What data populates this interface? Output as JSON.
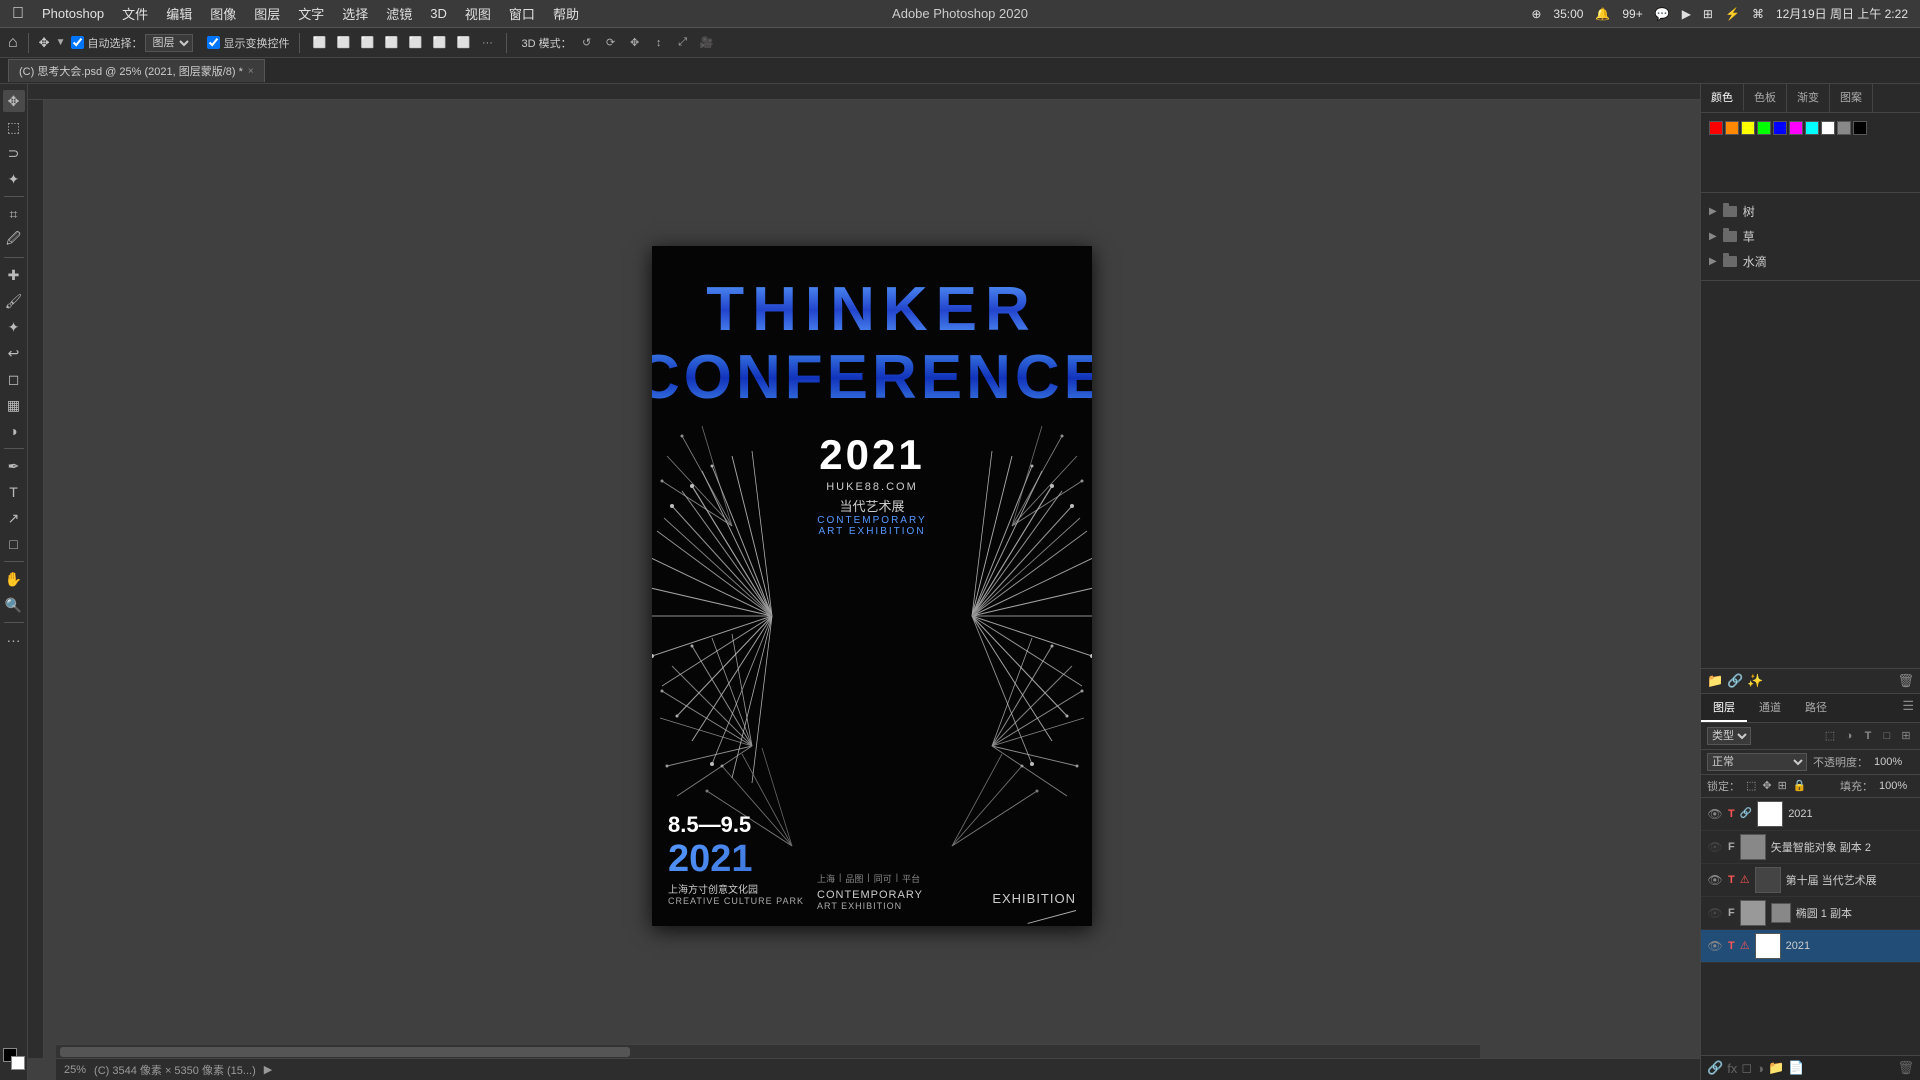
{
  "macos": {
    "apple": "&#63743;",
    "app_name": "Photoshop",
    "menus": [
      "文件",
      "编辑",
      "图像",
      "图层",
      "文字",
      "选择",
      "滤镜",
      "3D",
      "视图",
      "窗口",
      "帮助"
    ],
    "window_title": "Adobe Photoshop 2020",
    "right_icons": "35:00  99+  12月19日 周日 上午 2:22",
    "timer": "35:00",
    "notifications": "99+",
    "datetime": "12月19日 周日 上午 2:22"
  },
  "toolbar": {
    "auto_select_label": "自动选择：",
    "layer_option": "图层",
    "transform_label": "显示变换控件",
    "mode_label": "3D 模式："
  },
  "tab": {
    "title": "(C) 思考大会.psd @ 25% (2021, 图层蒙版/8) *",
    "close": "×"
  },
  "canvas": {
    "zoom": "25%",
    "info": "(C) 3544 像素 × 5350 像素 (15...)"
  },
  "poster": {
    "title_line1": "THINKER",
    "title_line2": "CONFERENCE",
    "year": "2021",
    "url": "HUKE88.COM",
    "chinese_subtitle": "当代艺术展",
    "subtitle_blue": "CONTEMPORARY",
    "subtitle_blue2": "ART EXHIBITION",
    "date": "8.5—9.5",
    "year_bottom": "2021",
    "park_chinese": "上海方寸创意文化园",
    "park_en": "CREATIVE CULTURE PARK",
    "contemp": "CONTEMPORARY",
    "art_exh": "ART EXHIBITION",
    "exhibition": "EXHIBITION"
  },
  "right_panel": {
    "top_tabs": [
      "颜色",
      "色板",
      "渐变",
      "图案"
    ],
    "layer_groups": [
      {
        "name": "树",
        "has_arrow": true
      },
      {
        "name": "草",
        "has_arrow": true
      },
      {
        "name": "水滴",
        "has_arrow": true
      }
    ]
  },
  "layers_panel": {
    "tabs": [
      "图层",
      "通道",
      "路径"
    ],
    "blend_mode": "正常",
    "opacity_label": "不透明度：",
    "opacity_val": "100%",
    "lock_label": "锁定：",
    "fill_label": "填充：",
    "fill_val": "100%",
    "search_placeholder": "类型",
    "layers": [
      {
        "name": "2021",
        "type": "text",
        "visible": true,
        "selected": false
      },
      {
        "name": "矢量智能对象 副本 2",
        "type": "smart",
        "visible": false,
        "selected": false
      },
      {
        "name": "第十届 当代艺术展",
        "type": "text",
        "visible": true,
        "selected": false
      },
      {
        "name": "椭圆 1 副本",
        "type": "smart",
        "visible": false,
        "selected": false
      },
      {
        "name": "2021",
        "type": "text",
        "visible": true,
        "selected": true
      }
    ]
  }
}
